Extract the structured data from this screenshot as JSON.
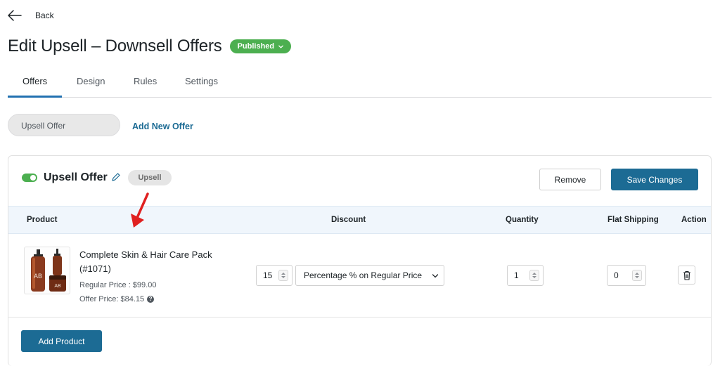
{
  "nav": {
    "back_label": "Back"
  },
  "header": {
    "title": "Edit Upsell – Downsell Offers",
    "status": "Published"
  },
  "tabs": [
    {
      "label": "Offers",
      "active": true
    },
    {
      "label": "Design",
      "active": false
    },
    {
      "label": "Rules",
      "active": false
    },
    {
      "label": "Settings",
      "active": false
    }
  ],
  "offers_bar": {
    "current_offer": "Upsell Offer",
    "add_new_label": "Add New Offer"
  },
  "offer": {
    "name": "Upsell Offer",
    "enabled": true,
    "type_badge": "Upsell",
    "remove_label": "Remove",
    "save_label": "Save Changes",
    "columns": {
      "product": "Product",
      "discount": "Discount",
      "quantity": "Quantity",
      "flat_shipping": "Flat Shipping",
      "action": "Action"
    },
    "product": {
      "name": "Complete Skin & Hair Care Pack (#1071)",
      "regular_price": "Regular Price : $99.00",
      "offer_price": "Offer Price: $84.15",
      "help_icon": "?",
      "discount_value": "15",
      "discount_type": "Percentage % on Regular Price",
      "quantity": "1",
      "flat_shipping": "0"
    },
    "add_product_label": "Add Product"
  },
  "colors": {
    "accent": "#1c6b94",
    "tab_underline": "#2271b1",
    "status_green": "#4caf50",
    "annotation_arrow": "#e02020"
  },
  "icons": {
    "back": "arrow-left-icon",
    "status": "chevron-down-icon",
    "edit": "pencil-icon",
    "select": "chevron-down-icon",
    "delete": "trash-icon"
  }
}
